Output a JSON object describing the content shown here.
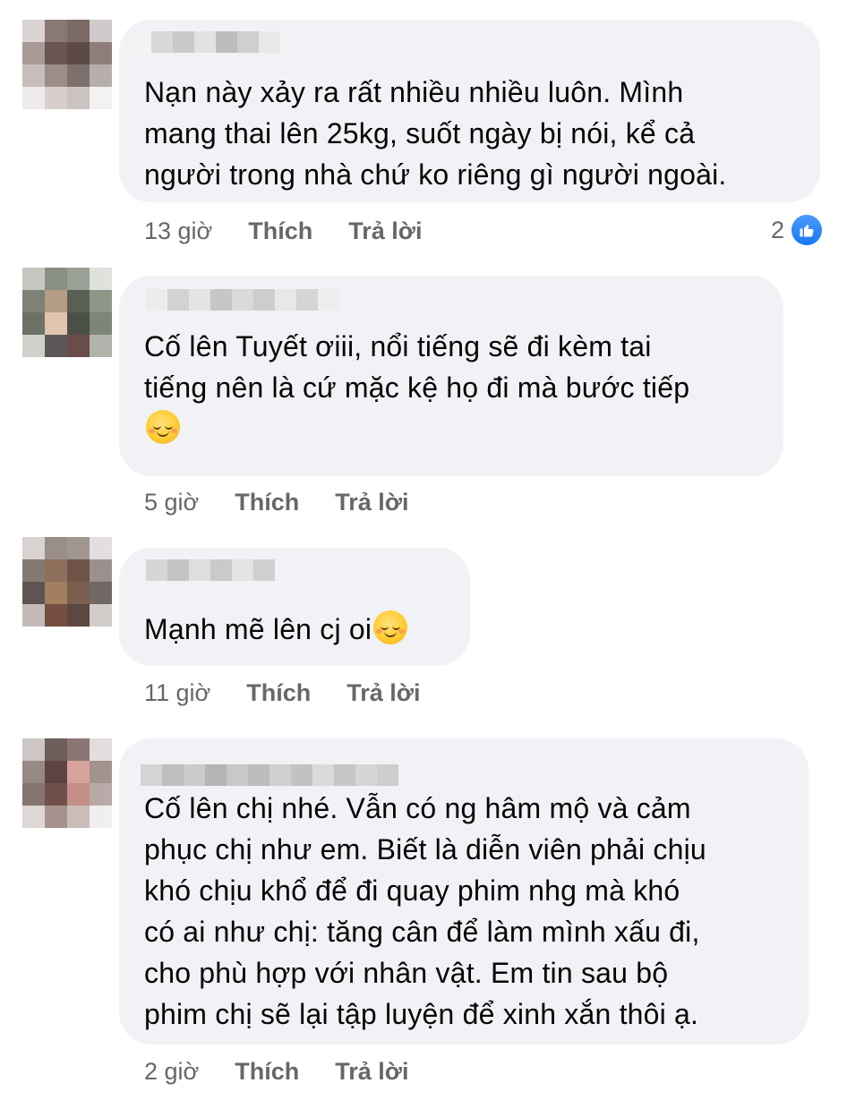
{
  "colors": {
    "bubble_bg": "#f0f2f5",
    "meta_text": "#65676b",
    "body_text": "#050505",
    "like_blue": "#1877f2"
  },
  "comments": [
    {
      "text": "Nạn này xảy ra rất nhiều nhiều luôn. Mình\nmang thai lên 25kg, suốt ngày bị nói, kể cả\nngười trong nhà chứ ko riêng gì người ngoài.",
      "time": "13 giờ",
      "like_label": "Thích",
      "reply_label": "Trả lời",
      "reaction_count": "2",
      "reaction_icon": "like-icon"
    },
    {
      "text": "Cố lên Tuyết ơiii, nổi tiếng sẽ đi kèm tai\ntiếng nên là cứ mặc kệ họ đi mà bước tiếp",
      "emoji": "relieved-face-icon",
      "time": "5 giờ",
      "like_label": "Thích",
      "reply_label": "Trả lời"
    },
    {
      "text": "Mạnh mẽ lên cj oi",
      "emoji": "smiling-face-icon",
      "time": "11 giờ",
      "like_label": "Thích",
      "reply_label": "Trả lời"
    },
    {
      "text": "Cố lên chị nhé. Vẫn có ng hâm mộ và cảm\nphục chị như em. Biết là diễn viên phải chịu\nkhó chịu khổ để đi quay phim nhg mà khó\ncó ai như chị: tăng cân để làm mình xấu đi,\ncho phù hợp với nhân vật. Em tin sau bộ\nphim chị sẽ lại tập luyện để xinh xắn thôi ạ.",
      "time": "2 giờ",
      "like_label": "Thích",
      "reply_label": "Trả lời"
    }
  ]
}
